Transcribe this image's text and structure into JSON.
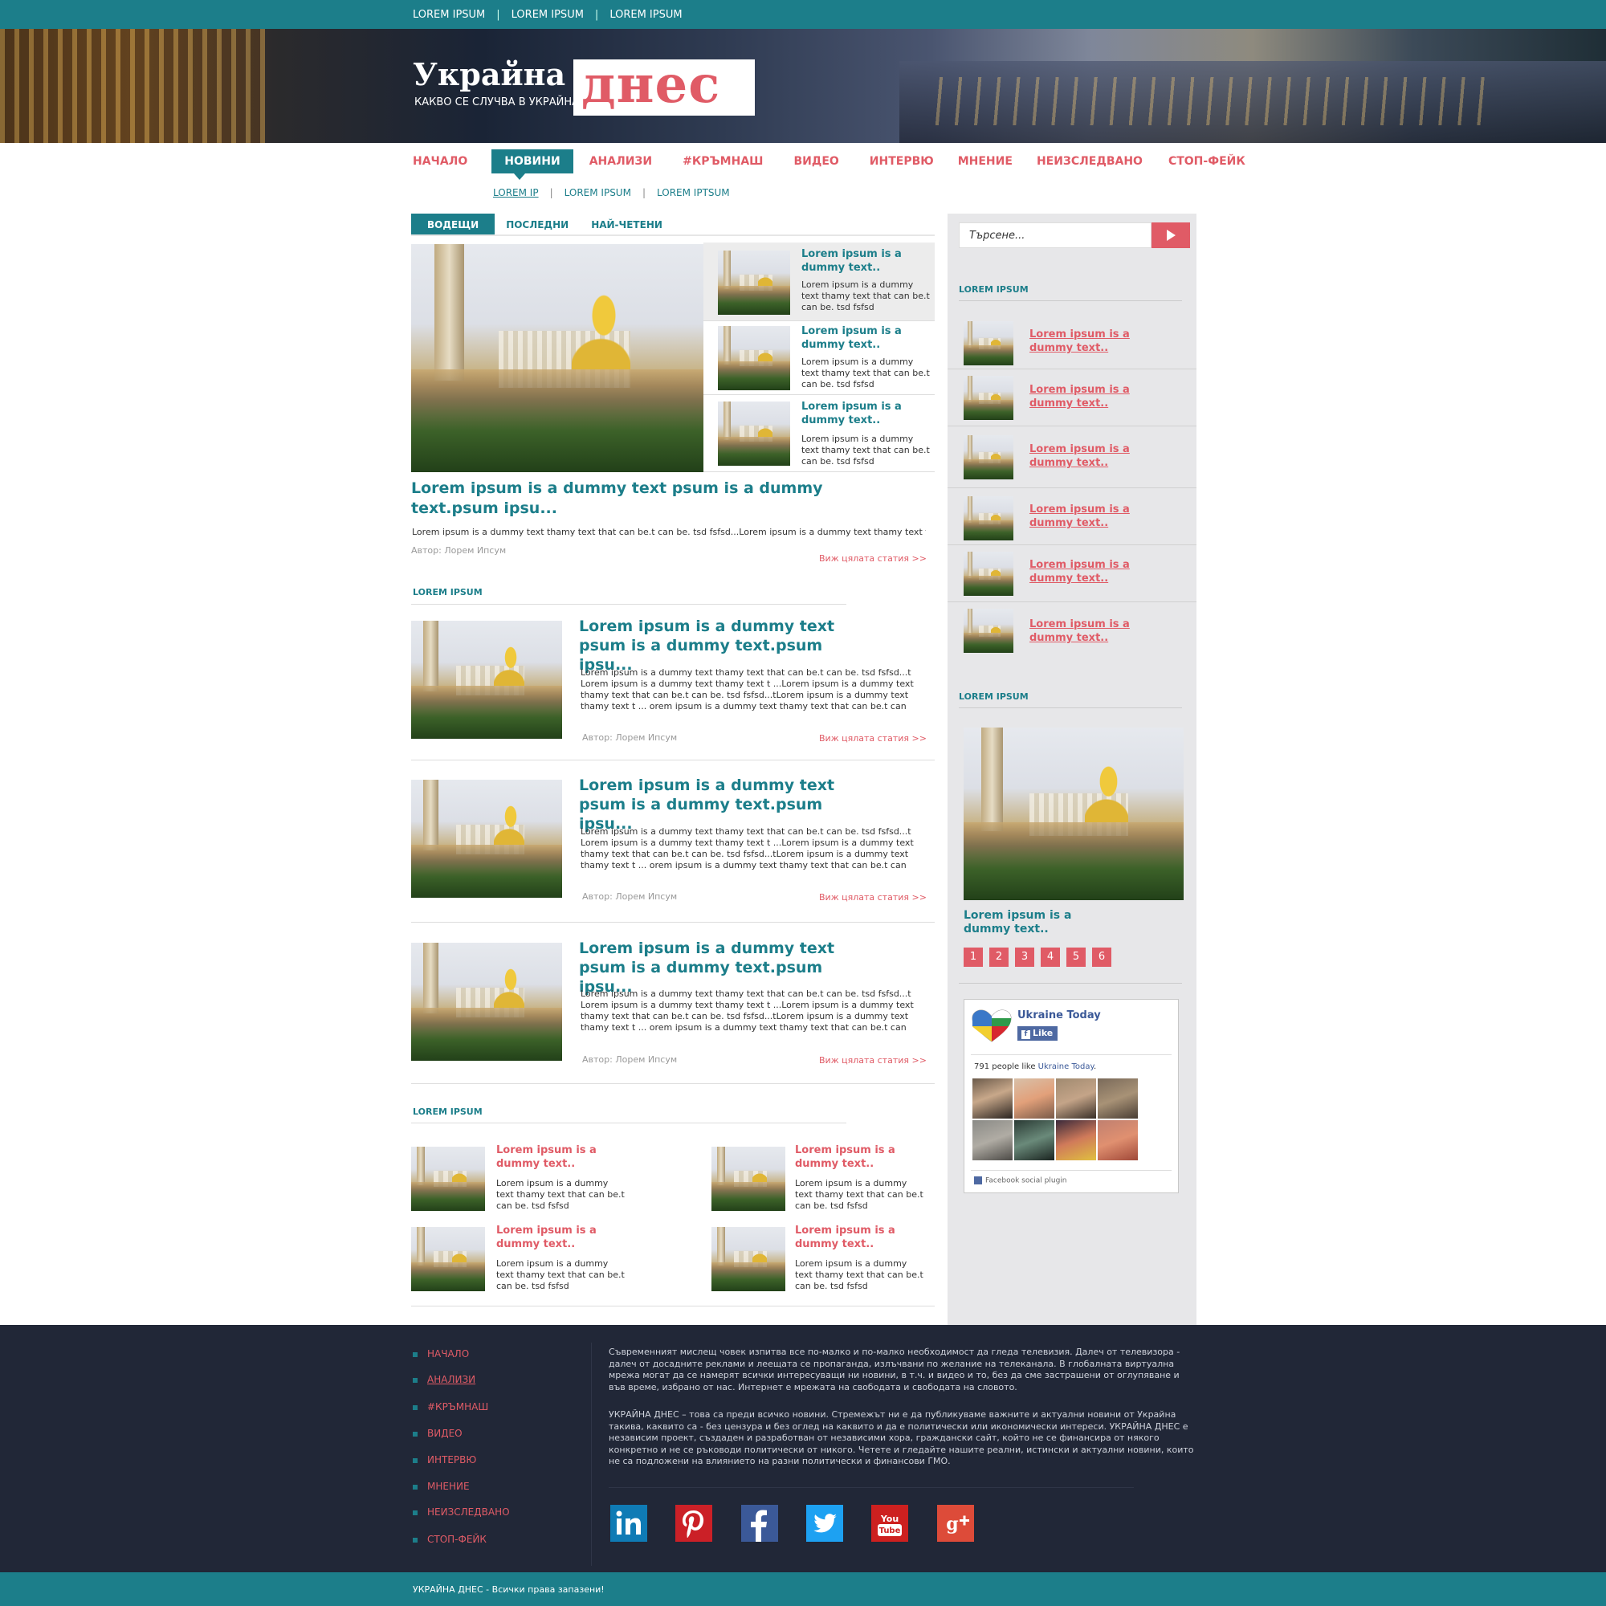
{
  "topbar": {
    "links": [
      "LOREM IPSUM",
      "LOREM IPSUM",
      "LOREM IPSUM"
    ],
    "separator": "|"
  },
  "logo": {
    "word1": "Украйна",
    "word2": "днес",
    "tagline": "КАКВО СЕ СЛУЧВА В УКРАЙНА"
  },
  "nav": {
    "items": [
      "НАЧАЛО",
      "НОВИНИ",
      "АНАЛИЗИ",
      "#КРЪМНАШ",
      "ВИДЕО",
      "ИНТЕРВЮ",
      "МНЕНИЕ",
      "НЕИЗСЛЕДВАНО",
      "СТОП-ФЕЙК"
    ],
    "active": "НОВИНИ",
    "subitems": [
      "LOREM IP",
      "LOREM IPSUM",
      "LOREM IPTSUM"
    ]
  },
  "tabs": [
    "ВОДЕЩИ",
    "ПОСЛЕДНИ",
    "НАЙ-ЧЕТЕНИ"
  ],
  "lead": {
    "side_items": [
      {
        "title": "Lorem ipsum is a dummy text..",
        "desc": "Lorem ipsum is a dummy text thamy text that can be.t can be. tsd fsfsd"
      },
      {
        "title": "Lorem ipsum is a dummy text..",
        "desc": "Lorem ipsum is a dummy text thamy text that can be.t can be. tsd fsfsd"
      },
      {
        "title": "Lorem ipsum is a dummy text..",
        "desc": "Lorem ipsum is a dummy text thamy text that can be.t can be. tsd fsfsd"
      }
    ],
    "title": "Lorem ipsum is a dummy text psum is a dummy text.psum ipsu...",
    "text": "Lorem ipsum is a dummy text thamy text that can be.t can be. tsd fsfsd...Lorem ipsum is a dummy text thamy text t ...",
    "author": "Автор: Лорем Ипсум",
    "more": "Виж цялата статия >>"
  },
  "section1": {
    "title": "LOREM IPSUM",
    "articles": [
      {
        "title": "Lorem ipsum is a dummy text psum is a dummy text.psum ipsu...",
        "text": "Lorem ipsum is a dummy text thamy text that can be.t can be. tsd fsfsd...t Lorem ipsum is a dummy text thamy text t ...Lorem ipsum is a dummy text thamy text that can be.t can be. tsd fsfsd...tLorem ipsum is a dummy text thamy text t ... orem ipsum is a dummy text thamy text that can be.t can",
        "author": "Автор: Лорем Ипсум",
        "more": "Виж цялата статия >>"
      },
      {
        "title": "Lorem ipsum is a dummy text psum is a dummy text.psum ipsu...",
        "text": "Lorem ipsum is a dummy text thamy text that can be.t can be. tsd fsfsd...t Lorem ipsum is a dummy text thamy text t ...Lorem ipsum is a dummy text thamy text that can be.t can be. tsd fsfsd...tLorem ipsum is a dummy text thamy text t ... orem ipsum is a dummy text thamy text that can be.t can",
        "author": "Автор: Лорем Ипсум",
        "more": "Виж цялата статия >>"
      },
      {
        "title": "Lorem ipsum is a dummy text psum is a dummy text.psum ipsu...",
        "text": "Lorem ipsum is a dummy text thamy text that can be.t can be. tsd fsfsd...t Lorem ipsum is a dummy text thamy text t ...Lorem ipsum is a dummy text thamy text that can be.t can be. tsd fsfsd...tLorem ipsum is a dummy text thamy text t ... orem ipsum is a dummy text thamy text that can be.t can",
        "author": "Автор: Лорем Ипсум",
        "more": "Виж цялата статия >>"
      }
    ]
  },
  "section2": {
    "title": "LOREM IPSUM",
    "items": [
      {
        "title": "Lorem ipsum is a dummy text..",
        "desc": "Lorem ipsum is a dummy text thamy text that can be.t can be. tsd fsfsd"
      },
      {
        "title": "Lorem ipsum is a dummy text..",
        "desc": "Lorem ipsum is a dummy text thamy text that can be.t can be. tsd fsfsd"
      },
      {
        "title": "Lorem ipsum is a dummy text..",
        "desc": "Lorem ipsum is a dummy text thamy text that can be.t can be. tsd fsfsd"
      },
      {
        "title": "Lorem ipsum is a dummy text..",
        "desc": "Lorem ipsum is a dummy text thamy text that can be.t can be. tsd fsfsd"
      }
    ]
  },
  "sidebar": {
    "search_placeholder": "Търсене...",
    "section1_title": "LOREM IPSUM",
    "list": [
      "Lorem ipsum is a dummy text..",
      "Lorem ipsum is a dummy text..",
      "Lorem ipsum is a dummy text..",
      "Lorem ipsum is a dummy text..",
      "Lorem ipsum is a dummy text..",
      "Lorem ipsum is a dummy text.."
    ],
    "section2_title": "LOREM IPSUM",
    "featured_title": "Lorem ipsum is a dummy text..",
    "pages": [
      "1",
      "2",
      "3",
      "4",
      "5",
      "6"
    ],
    "facebook": {
      "page_name": "Ukraine Today",
      "like_label": "Like",
      "count_text": "791 people like",
      "count_link": "Ukraine Today",
      "plugin_text": "Facebook social plugin"
    }
  },
  "footer": {
    "menu": [
      "НАЧАЛО",
      "АНАЛИЗИ",
      "#КРЪМНАШ",
      "ВИДЕО",
      "ИНТЕРВЮ",
      "МНЕНИЕ",
      "НЕИЗСЛЕДВАНО",
      "СТОП-ФЕЙК"
    ],
    "para1": "Съвременният мислещ човек изпитва все по-малко и по-малко необходимост да гледа телевизия. Далеч от телевизора - далеч от досадните реклами и леещата се пропаганда, излъчвани по желание на телеканала. В глобалната виртуална мрежа могат да се намерят всички интересуващи ни новини, в т.ч. и видео и то, без да сме застрашени от оглупяване и във време, избрано от нас. Интернет е мрежата на свободата и свободата на словото.",
    "para2": "УКРАЙНА ДНЕС – това са преди всичко новини. Стремежът ни е да публикуваме важните и актуални новини от Украйна такива, каквито са - без цензура и без оглед на каквито и да е политически или икономически интереси. УКРАЙНА ДНЕС е независим проект, създаден и разработван от независими хора, граждански сайт, който не се финансира от някого конкретно и не се ръководи политически от никого. Четете и гледайте нашите реални, истински и актуални новини, които не са подложени на влиянието на разни политически и финансови ГМО.",
    "social": [
      "linkedin-icon",
      "pinterest-icon",
      "facebook-icon",
      "twitter-icon",
      "youtube-icon",
      "google-plus-icon"
    ],
    "copyright": "УКРАЙНА ДНЕС - Всички права запазени!"
  },
  "colors": {
    "teal": "#1c7e8a",
    "coral": "#e05b66",
    "footer_bg": "#212737"
  }
}
